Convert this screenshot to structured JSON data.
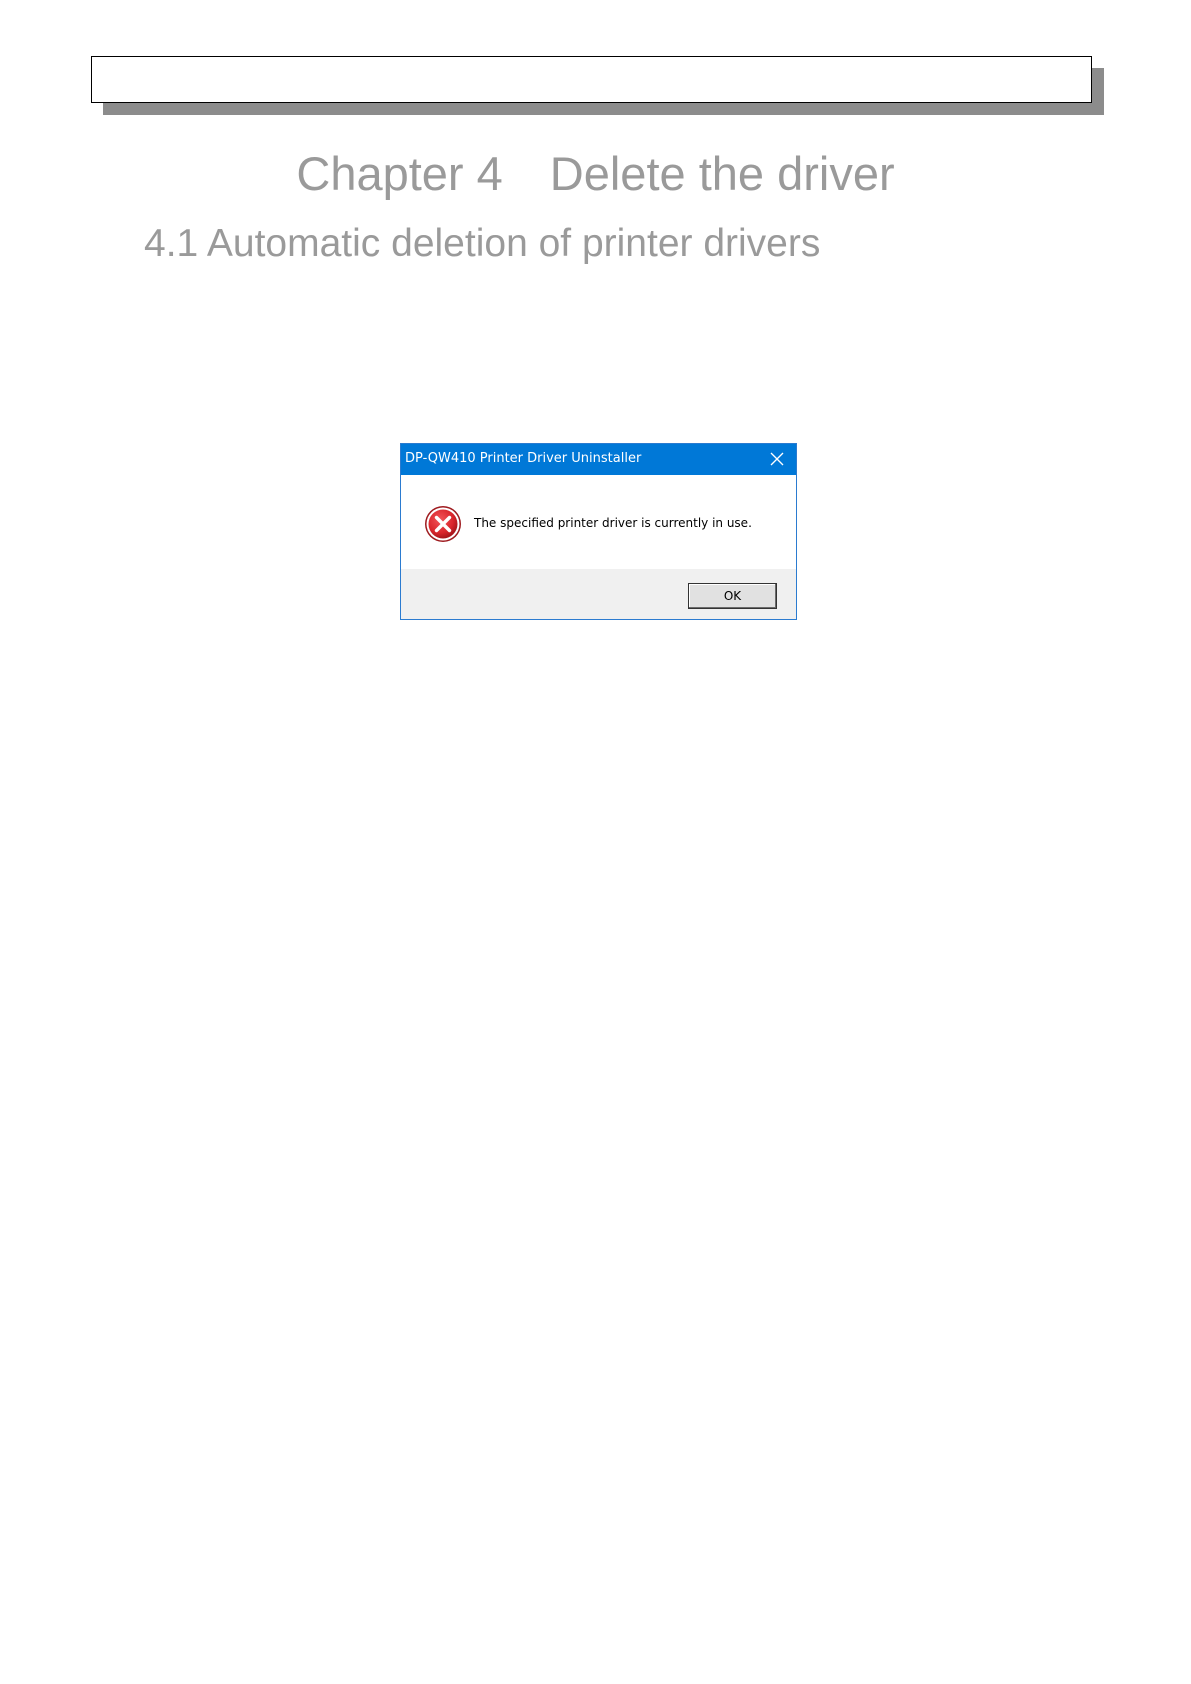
{
  "page": {
    "chapter_title": "Chapter 4　Delete the driver",
    "section_title": "4.1 Automatic deletion of printer drivers"
  },
  "dialog": {
    "title": "DP-QW410 Printer Driver Uninstaller",
    "message": "The specified printer driver is currently in use.",
    "ok_label": "OK",
    "icon": "error-icon",
    "close_icon": "close-icon",
    "titlebar_color": "#0078d7",
    "icon_color": "#d9252b"
  }
}
